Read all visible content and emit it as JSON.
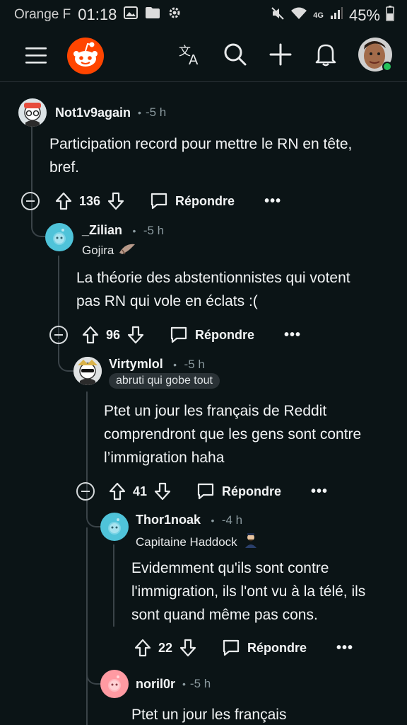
{
  "status_bar": {
    "carrier": "Orange F",
    "time": "01:18",
    "battery": "45%",
    "network": "4G",
    "icons": [
      "gallery-icon",
      "folder-icon",
      "settings-icon",
      "mute-icon",
      "wifi-icon",
      "signal-icon",
      "battery-icon"
    ]
  },
  "header": {
    "icons": [
      "menu-icon",
      "reddit-logo",
      "translate-icon",
      "search-icon",
      "create-icon",
      "notifications-icon",
      "profile-avatar"
    ]
  },
  "comments": [
    {
      "username": "Not1v9again",
      "time": "5 h",
      "flair": "",
      "body": [
        "Participation record pour mettre le RN en tête,",
        "bref."
      ],
      "score": "136",
      "reply_label": "Répondre",
      "more": "•••"
    },
    {
      "username": "_Zilian",
      "time": "5 h",
      "flair": "Gojira",
      "body": [
        "La théorie des abstentionnistes qui votent",
        "pas RN qui vole en éclats :("
      ],
      "score": "96",
      "reply_label": "Répondre",
      "more": "•••"
    },
    {
      "username": "Virtymlol",
      "time": "5 h",
      "flair": "abruti qui gobe tout",
      "body": [
        "Ptet un jour les français de Reddit",
        "comprendront que les gens sont contre",
        "l’immigration haha"
      ],
      "score": "41",
      "reply_label": "Répondre",
      "more": "•••"
    },
    {
      "username": "Thor1noak",
      "time": "4 h",
      "flair": "Capitaine Haddock",
      "body": [
        "Evidemment qu'ils sont contre",
        "l'immigration, ils l'ont vu à la télé, ils",
        "sont quand même pas cons."
      ],
      "score": "22",
      "reply_label": "Répondre",
      "more": "•••"
    },
    {
      "username": "noril0r",
      "time": "5 h",
      "flair": "",
      "body": [
        "Ptet un jour les français"
      ]
    }
  ],
  "colors": {
    "background": "#0b1416",
    "text": "#f2f4f5",
    "muted": "#8b9a9f",
    "thread_line": "#3a4348",
    "reddit_orange": "#ff4500",
    "avatar_teal": "#4fc3d9",
    "avatar_pink": "#ff9aa2"
  }
}
